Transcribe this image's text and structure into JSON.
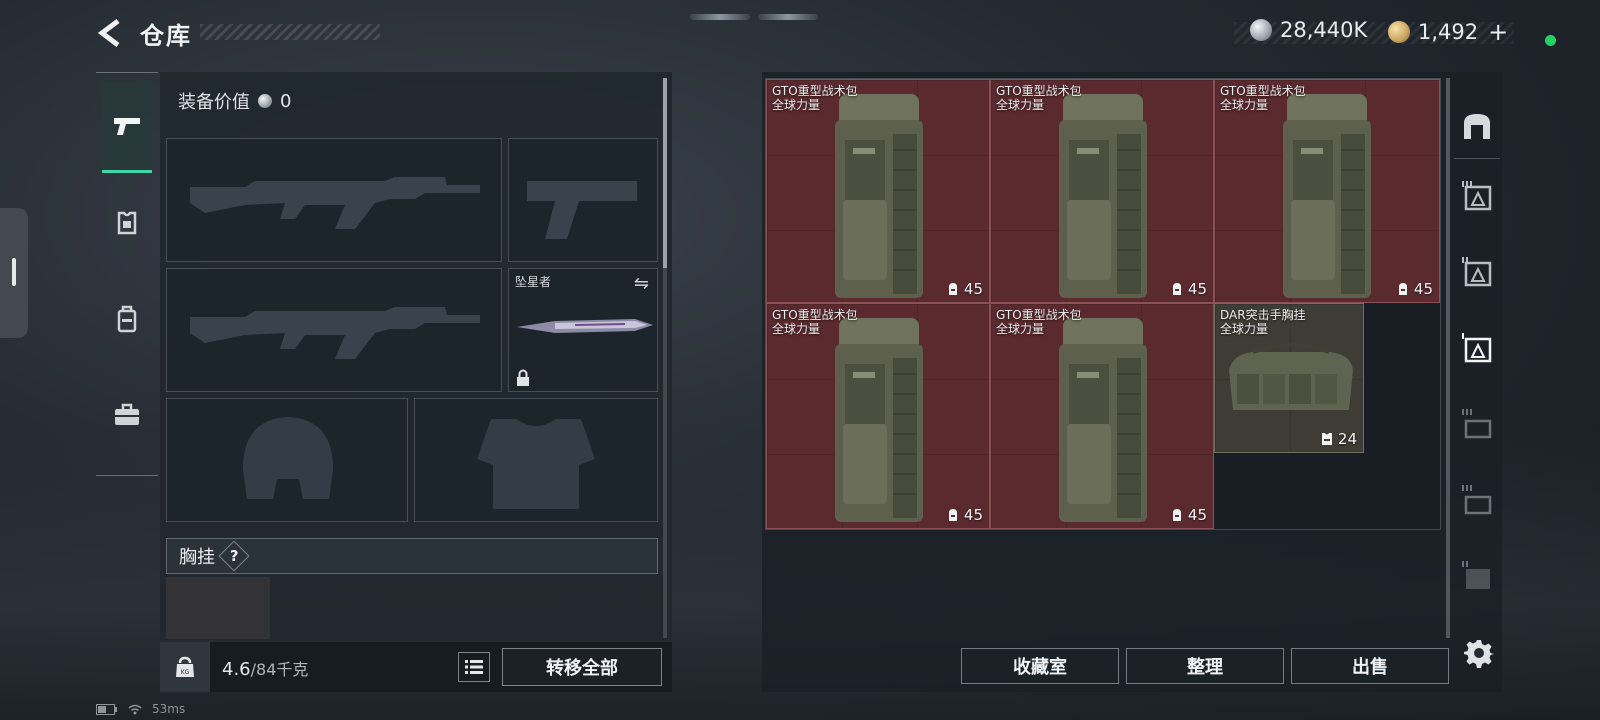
{
  "header": {
    "title": "仓库",
    "currencies": [
      {
        "icon": "silver-coin-icon",
        "amount": "28,440K"
      },
      {
        "icon": "gold-coin-icon",
        "amount": "1,492"
      }
    ],
    "plus_label": "+"
  },
  "left_rail": {
    "items": [
      {
        "name": "weapons",
        "icon": "pistol-icon",
        "active": true
      },
      {
        "name": "armor",
        "icon": "armor-icon",
        "active": false
      },
      {
        "name": "backpack",
        "icon": "backpack-icon",
        "active": false
      },
      {
        "name": "toolbox",
        "icon": "toolbox-icon",
        "active": false
      }
    ]
  },
  "equipment": {
    "value_label": "装备价值",
    "value_amount": "0",
    "melee_slot_label": "坠星者",
    "vest_section_label": "胸挂",
    "help_label": "?"
  },
  "weight": {
    "current": "4.6",
    "capacity": "/84千克",
    "transfer_all": "转移全部"
  },
  "storage": {
    "items": [
      {
        "name": "GTO重型战术包",
        "faction": "全球力量",
        "count": "45",
        "type": "backpack"
      },
      {
        "name": "GTO重型战术包",
        "faction": "全球力量",
        "count": "45",
        "type": "backpack"
      },
      {
        "name": "GTO重型战术包",
        "faction": "全球力量",
        "count": "45",
        "type": "backpack"
      },
      {
        "name": "GTO重型战术包",
        "faction": "全球力量",
        "count": "45",
        "type": "backpack"
      },
      {
        "name": "GTO重型战术包",
        "faction": "全球力量",
        "count": "45",
        "type": "backpack"
      },
      {
        "name": "DAR突击手胸挂",
        "faction": "全球力量",
        "count": "24",
        "type": "vest"
      }
    ],
    "buttons": {
      "collection": "收藏室",
      "organize": "整理",
      "sell": "出售"
    }
  },
  "right_rail": {
    "tabs": [
      "storage-home-icon",
      "storage-page-3-icon",
      "storage-page-2-icon",
      "storage-page-1-icon",
      "storage-page-4-icon",
      "storage-page-5-icon",
      "storage-page-6-icon"
    ],
    "settings_icon": "gear-icon"
  },
  "system": {
    "ping": "53ms"
  },
  "colors": {
    "accent": "#3fd6a8",
    "item_red": "#5a2a2f",
    "item_olive": "#3e3d35",
    "online": "#22d45f"
  }
}
